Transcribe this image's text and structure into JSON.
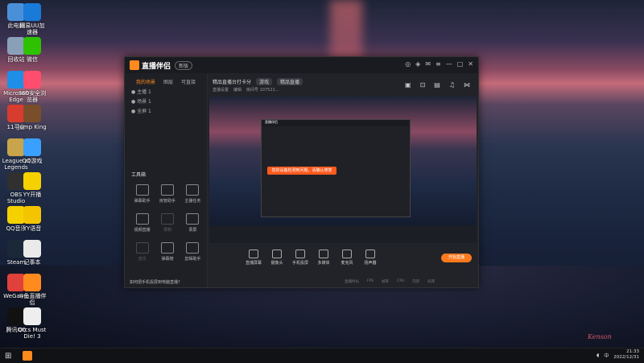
{
  "desktop_icons": [
    {
      "label": "此电脑",
      "icon": "computer-icon",
      "color": "#4a90d9"
    },
    {
      "label": "网易UU加速器",
      "icon": "uu-icon",
      "color": "#1a7ad8"
    },
    {
      "label": "回收站",
      "icon": "recycle-bin-icon",
      "color": "#8aa0b8"
    },
    {
      "label": "微信",
      "icon": "wechat-icon",
      "color": "#2dc100"
    },
    {
      "label": "Microsoft Edge",
      "icon": "edge-icon",
      "color": "#1e8ee6"
    },
    {
      "label": "360安全浏览器",
      "icon": "browser-360-icon",
      "color": "#ff4d6d"
    },
    {
      "label": "11平台",
      "icon": "platform11-icon",
      "color": "#d83c2e"
    },
    {
      "label": "Jump King",
      "icon": "jumpking-icon",
      "color": "#7a4e2a"
    },
    {
      "label": "League of Legends",
      "icon": "lol-icon",
      "color": "#c8a44a"
    },
    {
      "label": "QQ游戏",
      "icon": "qqgame-icon",
      "color": "#3aa0ff"
    },
    {
      "label": "OBS Studio",
      "icon": "obs-icon",
      "color": "#303030"
    },
    {
      "label": "YY开播",
      "icon": "yy-icon",
      "color": "#f5d100"
    },
    {
      "label": "QQ音乐",
      "icon": "qqmusic-icon",
      "color": "#f5d100"
    },
    {
      "label": "YY语音",
      "icon": "yyvoice-icon",
      "color": "#f5c400"
    },
    {
      "label": "Steam",
      "icon": "steam-icon",
      "color": "#1b2838"
    },
    {
      "label": "记事本",
      "icon": "notepad-icon",
      "color": "#eaeaea"
    },
    {
      "label": "WeGame",
      "icon": "wegame-icon",
      "color": "#e0413a"
    },
    {
      "label": "斗鱼直播伴侣",
      "icon": "douyu-icon",
      "color": "#ff8a1e"
    },
    {
      "label": "腾讯QQ",
      "icon": "qq-icon",
      "color": "#111111"
    },
    {
      "label": "Orcs Must Die! 3",
      "icon": "orcs-icon",
      "color": "#eeeeee"
    }
  ],
  "app": {
    "title": "直播伴侣",
    "version": "新版",
    "sidebar_tabs": [
      "我的场景",
      "图层",
      "可直接"
    ],
    "scene_items": [
      "● 主播 1",
      "● 场景 1",
      "● 全屏 1"
    ],
    "tools_title": "工具箱",
    "tools": [
      {
        "label": "弹幕助手",
        "dim": false
      },
      {
        "label": "房管助手",
        "dim": false
      },
      {
        "label": "主播任务",
        "dim": false
      },
      {
        "label": "视频直播",
        "dim": false
      },
      {
        "label": "录制",
        "dim": true
      },
      {
        "label": "录屏",
        "dim": false
      },
      {
        "label": "音乐",
        "dim": true
      },
      {
        "label": "弹幕榜",
        "dim": false
      },
      {
        "label": "剪辑助手",
        "dim": false
      }
    ],
    "sidebar_footer": "如何把手机投屏到电脑直播？",
    "room_title": "精品直播台打卡分",
    "room_tag": "游戏",
    "room_category": "精品直播",
    "meta": [
      "直播设置",
      "编辑",
      "房间号 107521..."
    ],
    "toast": "您的设备检测到问题，请确认修复",
    "controls": [
      "直播屏幕",
      "摄像头",
      "手机投屏",
      "多媒体",
      "麦克风",
      "扬声器"
    ],
    "live_button": "开始直播",
    "status": [
      "直播时长",
      "FPS",
      "帧率",
      "CPU",
      "内存",
      "码率"
    ]
  },
  "taskbar": {
    "time": "21:33",
    "date": "2022/12/31"
  },
  "signature": "Kenson"
}
